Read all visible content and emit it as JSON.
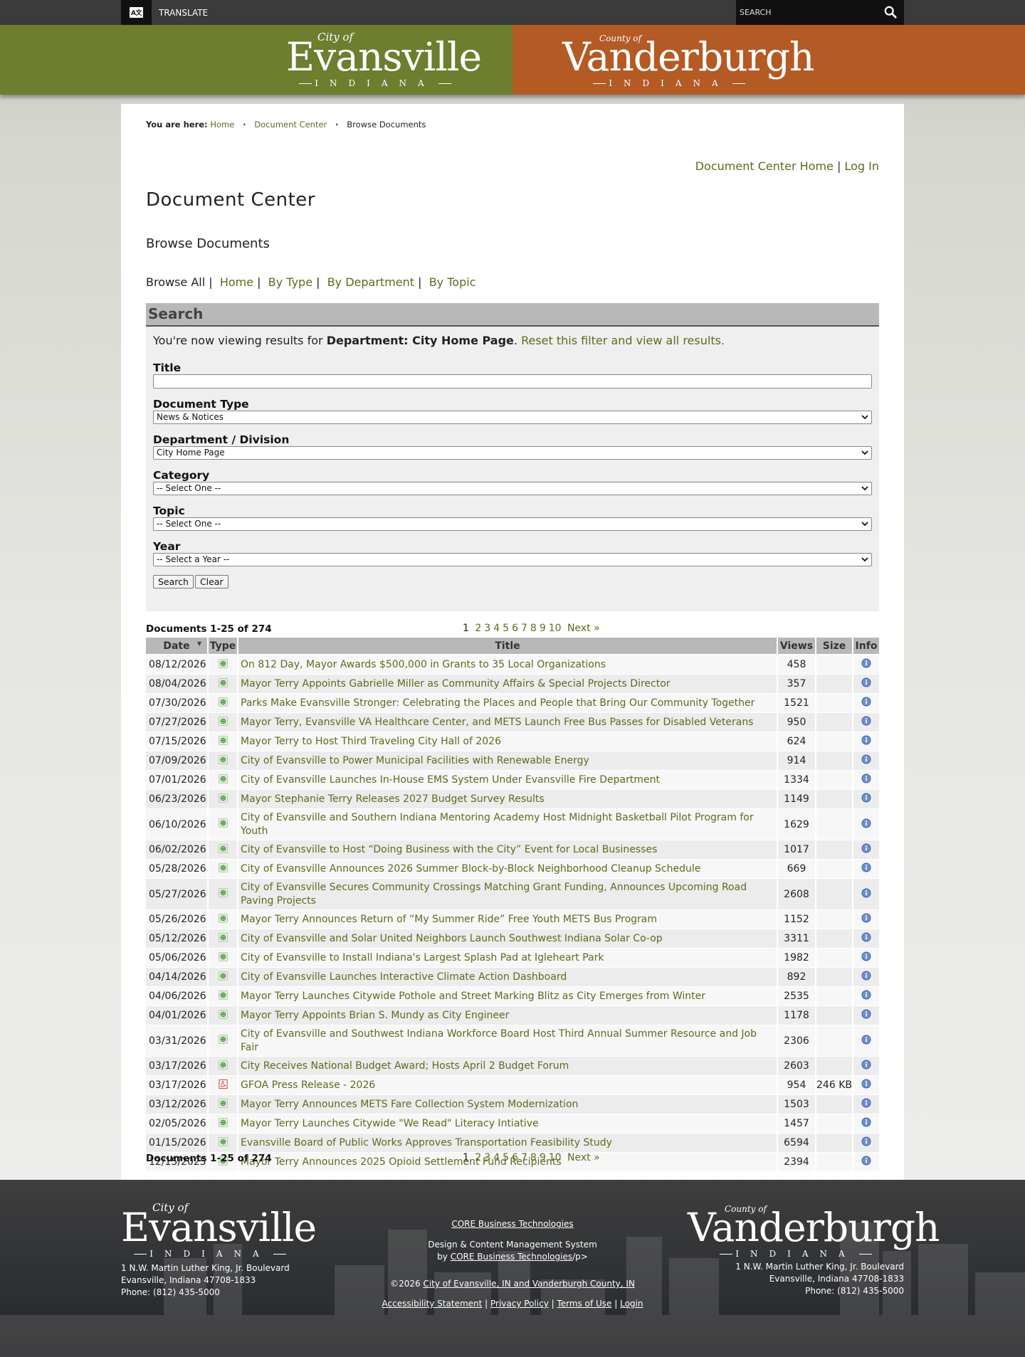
{
  "topbar": {
    "translate_label": "TRANSLATE",
    "translate_icon_text": "A文",
    "search_placeholder": "SEARCH"
  },
  "banner": {
    "city": {
      "small": "City of",
      "big": "Evansville",
      "state": "INDIANA"
    },
    "county": {
      "small": "County of",
      "big": "Vanderburgh",
      "state": "INDIANA"
    }
  },
  "breadcrumb": {
    "label": "You are here:",
    "items": [
      "Home",
      "Document Center",
      "Browse Documents"
    ]
  },
  "toplinks": {
    "home": "Document Center Home",
    "sep": "|",
    "login": "Log In"
  },
  "page_title": "Document Center",
  "subtitle": "Browse Documents",
  "browse_nav": {
    "current": "Browse All",
    "links": [
      "Home",
      "By Type",
      "By Department",
      "By Topic"
    ]
  },
  "search": {
    "header": "Search",
    "notice_prefix": "You're now viewing results for ",
    "notice_bold": "Department: City Home Page",
    "notice_suffix": ". ",
    "notice_link": "Reset this filter and view all results.",
    "fields": {
      "title_label": "Title",
      "title_value": "",
      "type_label": "Document Type",
      "type_value": "News & Notices",
      "dept_label": "Department / Division",
      "dept_value": "City Home Page",
      "category_label": "Category",
      "category_value": "-- Select One --",
      "topic_label": "Topic",
      "topic_value": "-- Select One --",
      "year_label": "Year",
      "year_value": "-- Select a Year --"
    },
    "search_button": "Search",
    "clear_button": "Clear"
  },
  "documents": {
    "count_label": "Documents 1-25 of 274",
    "pager": {
      "current": "1",
      "pages": [
        "2",
        "3",
        "4",
        "5",
        "6",
        "7",
        "8",
        "9",
        "10"
      ],
      "next": "Next »"
    },
    "columns": [
      "Date",
      "Type",
      "Title",
      "Views",
      "Size",
      "Info"
    ],
    "rows": [
      {
        "date": "08/12/2026",
        "type": "web",
        "title": "On 812 Day, Mayor Awards $500,000 in Grants to 35 Local Organizations",
        "views": "458",
        "size": ""
      },
      {
        "date": "08/04/2026",
        "type": "web",
        "title": "Mayor Terry Appoints Gabrielle Miller as Community Affairs & Special Projects Director",
        "views": "357",
        "size": ""
      },
      {
        "date": "07/30/2026",
        "type": "web",
        "title": "Parks Make Evansville Stronger: Celebrating the Places and People that Bring Our Community Together",
        "views": "1521",
        "size": ""
      },
      {
        "date": "07/27/2026",
        "type": "web",
        "title": "Mayor Terry, Evansville VA Healthcare Center, and METS Launch Free Bus Passes for Disabled Veterans",
        "views": "950",
        "size": ""
      },
      {
        "date": "07/15/2026",
        "type": "web",
        "title": "Mayor Terry to Host Third Traveling City Hall of 2026",
        "views": "624",
        "size": ""
      },
      {
        "date": "07/09/2026",
        "type": "web",
        "title": "City of Evansville to Power Municipal Facilities with Renewable Energy",
        "views": "914",
        "size": ""
      },
      {
        "date": "07/01/2026",
        "type": "web",
        "title": "City of Evansville Launches In-House EMS System Under Evansville Fire Department",
        "views": "1334",
        "size": ""
      },
      {
        "date": "06/23/2026",
        "type": "web",
        "title": "Mayor Stephanie Terry Releases 2027 Budget Survey Results",
        "views": "1149",
        "size": ""
      },
      {
        "date": "06/10/2026",
        "type": "web",
        "title": "City of Evansville and Southern Indiana Mentoring Academy Host Midnight Basketball Pilot Program for Youth",
        "views": "1629",
        "size": ""
      },
      {
        "date": "06/02/2026",
        "type": "web",
        "title": "City of Evansville to Host “Doing Business with the City” Event for Local Businesses",
        "views": "1017",
        "size": ""
      },
      {
        "date": "05/28/2026",
        "type": "web",
        "title": "City of Evansville Announces 2026 Summer Block-by-Block Neighborhood Cleanup Schedule",
        "views": "669",
        "size": ""
      },
      {
        "date": "05/27/2026",
        "type": "web",
        "title": "City of Evansville Secures Community Crossings Matching Grant Funding, Announces Upcoming Road Paving Projects",
        "views": "2608",
        "size": ""
      },
      {
        "date": "05/26/2026",
        "type": "web",
        "title": "Mayor Terry Announces Return of “My Summer Ride” Free Youth METS Bus Program",
        "views": "1152",
        "size": ""
      },
      {
        "date": "05/12/2026",
        "type": "web",
        "title": "City of Evansville and Solar United Neighbors Launch Southwest Indiana Solar Co-op",
        "views": "3311",
        "size": ""
      },
      {
        "date": "05/06/2026",
        "type": "web",
        "title": "City of Evansville to Install Indiana's Largest Splash Pad at Igleheart Park",
        "views": "1982",
        "size": ""
      },
      {
        "date": "04/14/2026",
        "type": "web",
        "title": "City of Evansville Launches Interactive Climate Action Dashboard",
        "views": "892",
        "size": ""
      },
      {
        "date": "04/06/2026",
        "type": "web",
        "title": "Mayor Terry Launches Citywide Pothole and Street Marking Blitz as City Emerges from Winter",
        "views": "2535",
        "size": ""
      },
      {
        "date": "04/01/2026",
        "type": "web",
        "title": "Mayor Terry Appoints Brian S. Mundy as City Engineer",
        "views": "1178",
        "size": ""
      },
      {
        "date": "03/31/2026",
        "type": "web",
        "title": "City of Evansville and Southwest Indiana Workforce Board Host Third Annual Summer Resource and Job Fair",
        "views": "2306",
        "size": ""
      },
      {
        "date": "03/17/2026",
        "type": "web",
        "title": "City Receives National Budget Award; Hosts April 2 Budget Forum",
        "views": "2603",
        "size": ""
      },
      {
        "date": "03/17/2026",
        "type": "pdf",
        "title": "GFOA Press Release - 2026",
        "views": "954",
        "size": "246 KB"
      },
      {
        "date": "03/12/2026",
        "type": "web",
        "title": "Mayor Terry Announces METS Fare Collection System Modernization",
        "views": "1503",
        "size": ""
      },
      {
        "date": "02/05/2026",
        "type": "web",
        "title": "Mayor Terry Launches Citywide \"We Read\" Literacy Intiative",
        "views": "1457",
        "size": ""
      },
      {
        "date": "01/15/2026",
        "type": "web",
        "title": "Evansville Board of Public Works Approves Transportation Feasibility Study",
        "views": "6594",
        "size": ""
      },
      {
        "date": "12/15/2025",
        "type": "web",
        "title": "Mayor Terry Announces 2025 Opioid Settlement Fund Recipients",
        "views": "2394",
        "size": ""
      }
    ]
  },
  "footer": {
    "left_address": [
      "1 N.W. Martin Luther King, Jr. Boulevard",
      "Evansville, Indiana 47708-1833",
      "Phone: (812) 435-5000"
    ],
    "right_address": [
      "1 N.W. Martin Luther King, Jr. Boulevard",
      "Evansville, Indiana 47708-1833",
      "Phone: (812) 435-5000"
    ],
    "core_link": "CORE Business Technologies",
    "design_line": "Design & Content Management System",
    "by_prefix": "by ",
    "by_link": "CORE Business Technologies",
    "by_suffix": "/p>",
    "copyright_prefix": "©2026 ",
    "copyright_link": "City of Evansville, IN and Vanderburgh County, IN",
    "links": [
      "Accessibility Statement",
      "Privacy Policy",
      "Terms of Use",
      "Login"
    ]
  },
  "colors": {
    "city_green": "#6d7e2e",
    "county_orange": "#b45a24",
    "link_green": "#5c6b1e",
    "table_header": "#b8b8b8"
  }
}
